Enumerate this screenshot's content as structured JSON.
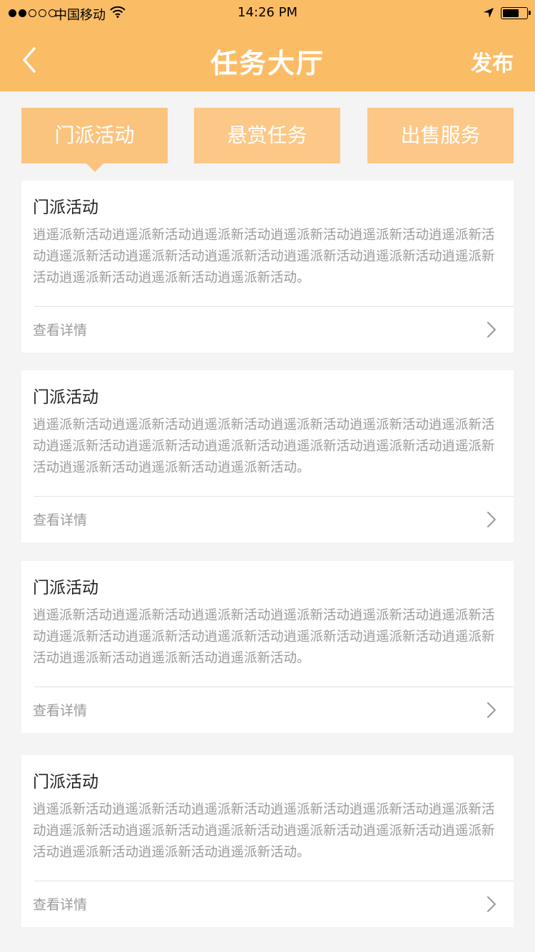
{
  "status_bar": {
    "carrier": "中国移动",
    "time": "14:26 PM",
    "signal_bars_filled": 2,
    "signal_bars_total": 5
  },
  "nav": {
    "title": "任务大厅",
    "publish_label": "发布",
    "back_icon": "chevron-left-icon"
  },
  "tabs": [
    {
      "label": "门派活动",
      "active": true
    },
    {
      "label": "悬赏任务",
      "active": false
    },
    {
      "label": "出售服务",
      "active": false
    }
  ],
  "cards": [
    {
      "title": "门派活动",
      "description": "逍遥派新活动逍遥派新活动逍遥派新活动逍遥派新活动逍遥派新活动逍遥派新活动逍遥派新活动逍遥派新活动逍遥派新活动逍遥派新活动逍遥派新活动逍遥派新活动逍遥派新活动逍遥派新活动逍遥派新活动。",
      "link_label": "查看详情"
    },
    {
      "title": "门派活动",
      "description": "逍遥派新活动逍遥派新活动逍遥派新活动逍遥派新活动逍遥派新活动逍遥派新活动逍遥派新活动逍遥派新活动逍遥派新活动逍遥派新活动逍遥派新活动逍遥派新活动逍遥派新活动逍遥派新活动逍遥派新活动。",
      "link_label": "查看详情"
    },
    {
      "title": "门派活动",
      "description": "逍遥派新活动逍遥派新活动逍遥派新活动逍遥派新活动逍遥派新活动逍遥派新活动逍遥派新活动逍遥派新活动逍遥派新活动逍遥派新活动逍遥派新活动逍遥派新活动逍遥派新活动逍遥派新活动逍遥派新活动。",
      "link_label": "查看详情"
    },
    {
      "title": "门派活动",
      "description": "逍遥派新活动逍遥派新活动逍遥派新活动逍遥派新活动逍遥派新活动逍遥派新活动逍遥派新活动逍遥派新活动逍遥派新活动逍遥派新活动逍遥派新活动逍遥派新活动逍遥派新活动逍遥派新活动逍遥派新活动。",
      "link_label": "查看详情"
    }
  ],
  "colors": {
    "header": "#fbbc66",
    "tab": "#fcc887",
    "background": "#f4f4f4"
  }
}
